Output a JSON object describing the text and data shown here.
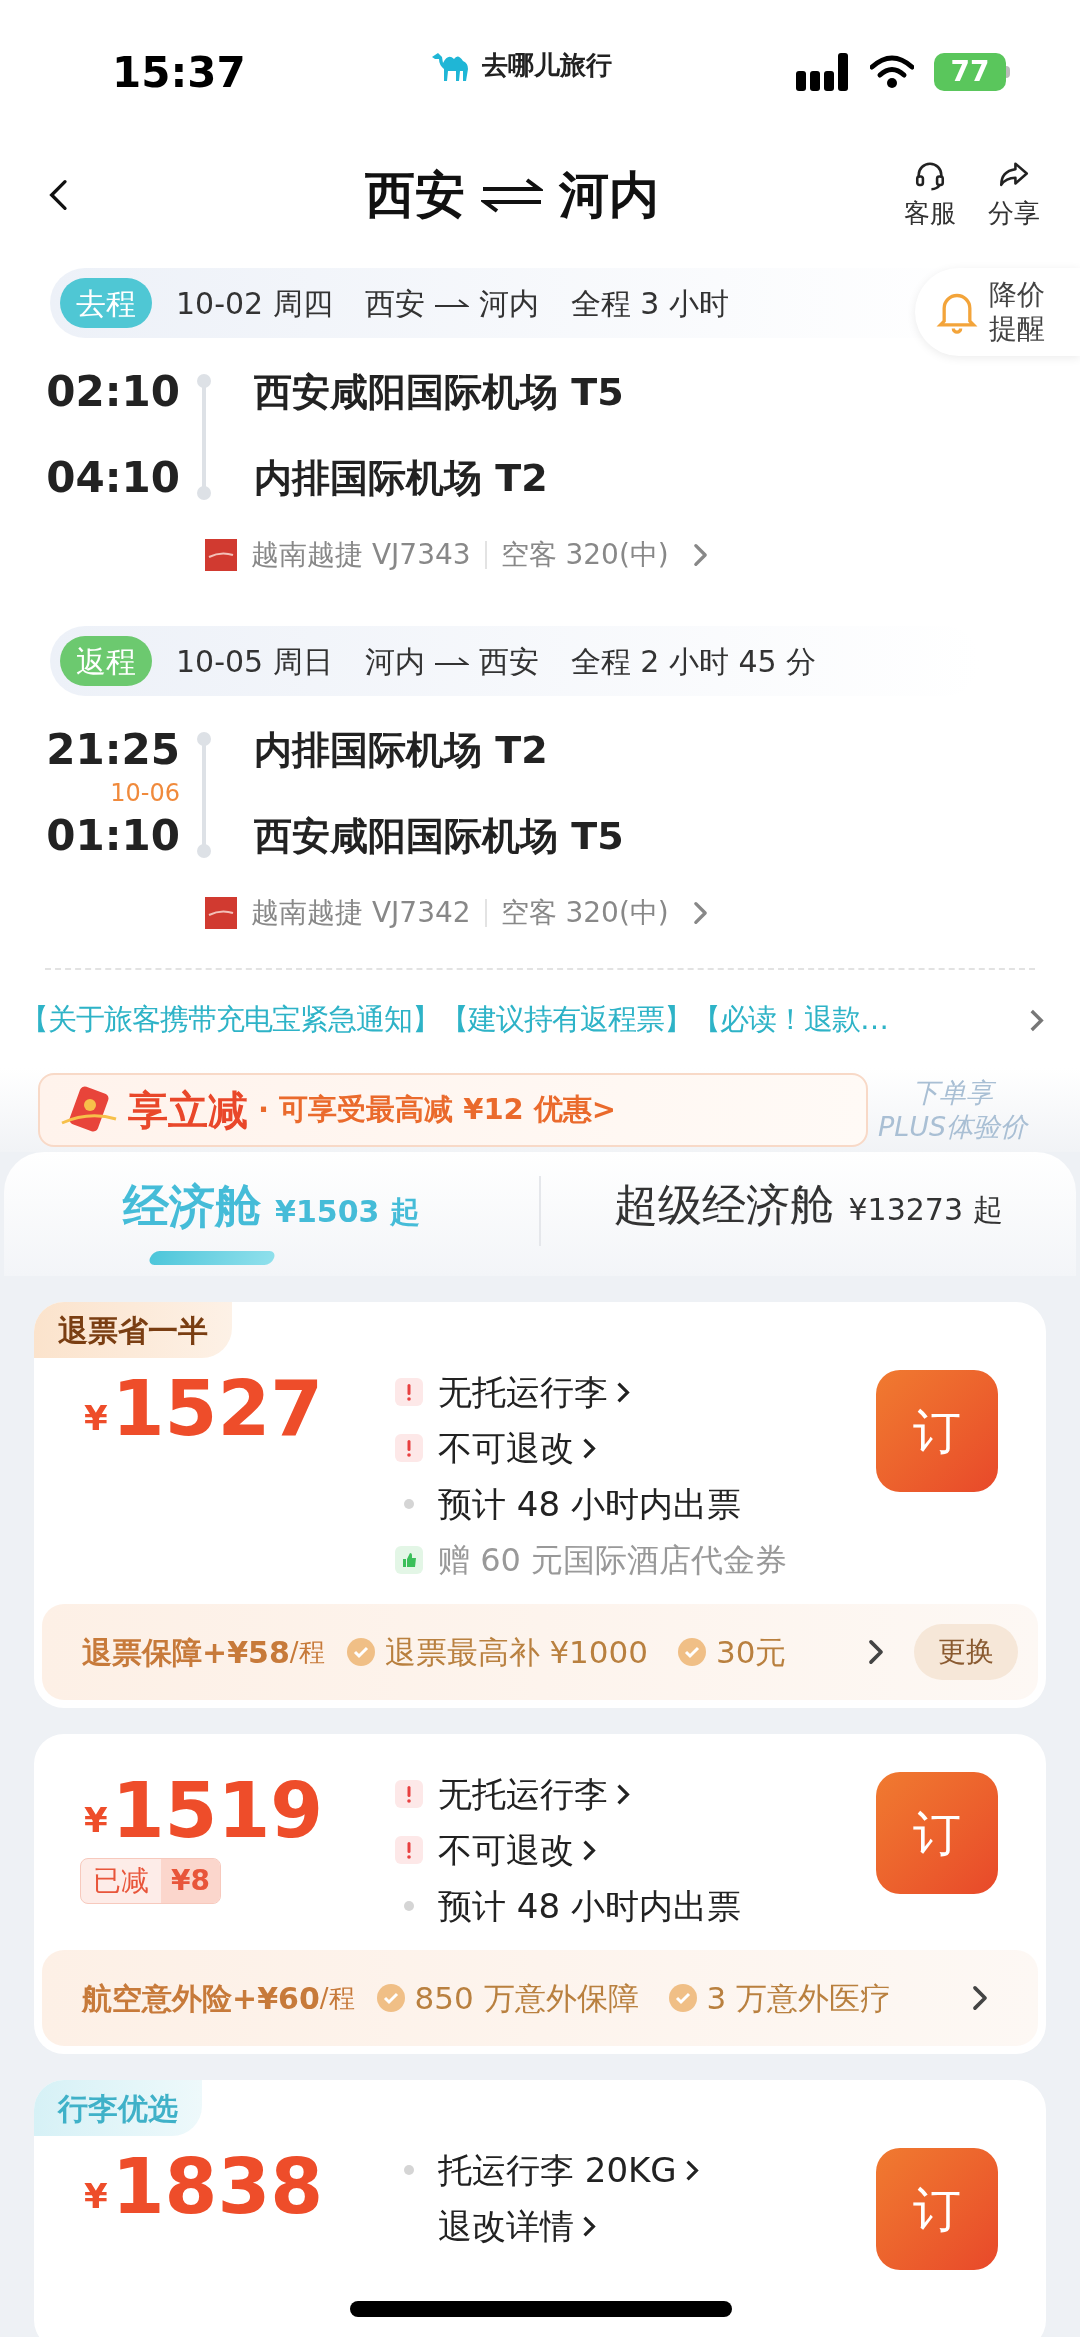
{
  "status_bar": {
    "time": "15:37",
    "app_name": "去哪儿旅行",
    "battery": "77"
  },
  "header": {
    "from": "西安",
    "to": "河内",
    "actions": [
      {
        "kind": "service",
        "label": "客服"
      },
      {
        "kind": "share",
        "label": "分享"
      }
    ]
  },
  "price_alert": {
    "lines": [
      "降价",
      "提醒"
    ]
  },
  "legs": [
    {
      "tag": "去程",
      "color": "#4fc7d4",
      "date": "10-02 周四",
      "route_from": "西安",
      "route_to": "河内",
      "duration": "全程 3 小时",
      "dep_time": "02:10",
      "dep_airport": "西安咸阳国际机场 T5",
      "arr_time": "04:10",
      "arr_airport": "内排国际机场 T2",
      "airline": "越南越捷 VJ7343",
      "aircraft": "空客 320(中)"
    },
    {
      "tag": "返程",
      "color": "#6cc96f",
      "date": "10-05 周日",
      "route_from": "河内",
      "route_to": "西安",
      "duration": "全程 2 小时 45 分",
      "dep_time": "21:25",
      "dep_airport": "内排国际机场 T2",
      "arr_date": "10-06",
      "arr_time": "01:10",
      "arr_airport": "西安咸阳国际机场 T5",
      "airline": "越南越捷 VJ7342",
      "aircraft": "空客 320(中)"
    }
  ],
  "notice": "【关于旅客携带充电宝紧急通知】【建议持有返程票】【必读！退款…",
  "promo": {
    "title": "享立减",
    "text": "· 可享受最高减 ¥12 优惠>"
  },
  "plus": [
    "下单享",
    "PLUS体验价"
  ],
  "cabin_tabs": [
    {
      "label": "经济舱",
      "price": "¥1503 起",
      "selected": true
    },
    {
      "label": "超级经济舱",
      "price": "¥13273 起",
      "selected": false
    }
  ],
  "offers": [
    {
      "tag": {
        "text": "退票省一半",
        "kind": "warm"
      },
      "currency": "¥",
      "price": "1527",
      "features": [
        {
          "kind": "warning",
          "text": "无托运行李",
          "link": true
        },
        {
          "kind": "warning",
          "text": "不可退改",
          "link": true
        },
        {
          "kind": "dot",
          "text": "预计 48 小时内出票",
          "link": false
        },
        {
          "kind": "gift",
          "text": "赠 60 元国际酒店代金券",
          "link": false
        }
      ],
      "button": "订",
      "addon": {
        "title": "退票保障",
        "price": "+¥58",
        "unit": "/程",
        "benefits": [
          "退票最高补 ¥1000",
          "30元"
        ],
        "action": "更换"
      }
    },
    {
      "currency": "¥",
      "price": "1519",
      "discount": {
        "label": "已减",
        "amount": "¥8"
      },
      "features": [
        {
          "kind": "warning",
          "text": "无托运行李",
          "link": true
        },
        {
          "kind": "warning",
          "text": "不可退改",
          "link": true
        },
        {
          "kind": "dot",
          "text": "预计 48 小时内出票",
          "link": false
        }
      ],
      "button": "订",
      "addon": {
        "title": "航空意外险",
        "price": "+¥60",
        "unit": "/程",
        "benefits": [
          "850 万意外保障",
          "3 万意外医疗"
        ]
      }
    },
    {
      "tag": {
        "text": "行李优选",
        "kind": "cool"
      },
      "currency": "¥",
      "price": "1838",
      "features": [
        {
          "kind": "dot",
          "text": "托运行李 20KG",
          "link": true
        },
        {
          "kind": "plain",
          "text": "退改详情",
          "link": true
        }
      ],
      "button": "订"
    }
  ]
}
